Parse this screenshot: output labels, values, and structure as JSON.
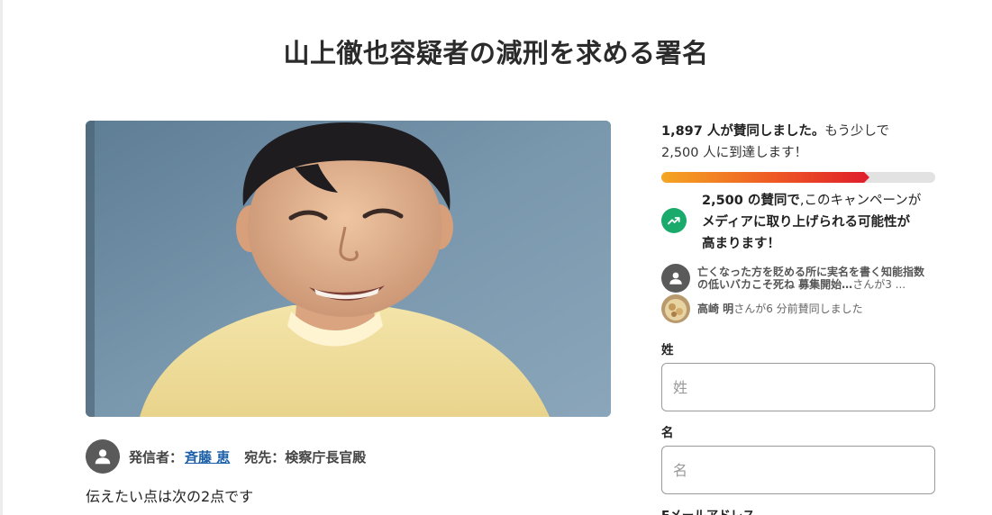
{
  "page": {
    "title": "山上徹也容疑者の減刑を求める署名"
  },
  "author": {
    "sender_label": "発信者：",
    "sender_name": "斉藤 恵",
    "recipient_label": "宛先：検察庁長官殿"
  },
  "body": {
    "intro": "伝えたい点は次の2点です"
  },
  "signatures": {
    "count": "1,897 人が賛同しました。",
    "line1_rest": "もう少しで",
    "line2": "2,500 人に到達します！",
    "progress_fraction": 0.7588
  },
  "milestone": {
    "line1_bold": "2,500 の賛同で",
    "line1_rest": ",このキャンペーンが",
    "line2": "メディアに取り上げられる可能性が",
    "line3": "高まります！",
    "icon": "trending-up-icon",
    "color": "#1aaa6b"
  },
  "recent": [
    {
      "name": "亡くなった方を貶める所に実名を書く知能指数の低いバカこそ死ね 募集開始…",
      "action": "さんが3 ..."
    },
    {
      "name": "高崎 明",
      "action": "さんが6 分前賛同しました"
    }
  ],
  "form": {
    "last_name_label": "姓",
    "last_name_placeholder": "姓",
    "first_name_label": "名",
    "first_name_placeholder": "名",
    "email_label": "Eメールアドレス"
  },
  "colors": {
    "link": "#1a5fa8",
    "progress_start": "#f5a623",
    "progress_end": "#e0202a"
  }
}
